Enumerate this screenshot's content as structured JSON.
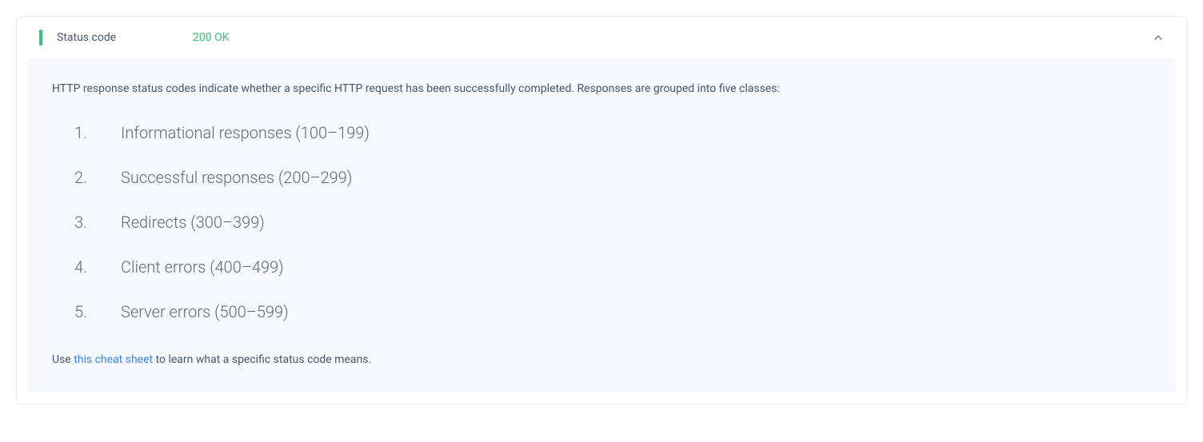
{
  "header": {
    "label": "Status code",
    "value": "200 OK"
  },
  "body": {
    "intro": "HTTP response status codes indicate whether a specific HTTP request has been successfully completed. Responses are grouped into five classes:",
    "classes": [
      "Informational responses (100–199)",
      "Successful responses (200–299)",
      "Redirects (300–399)",
      "Client errors (400–499)",
      "Server errors (500–599)"
    ],
    "footer": {
      "prefix": "Use ",
      "link_text": "this cheat sheet",
      "suffix": " to learn what a specific status code means."
    }
  }
}
